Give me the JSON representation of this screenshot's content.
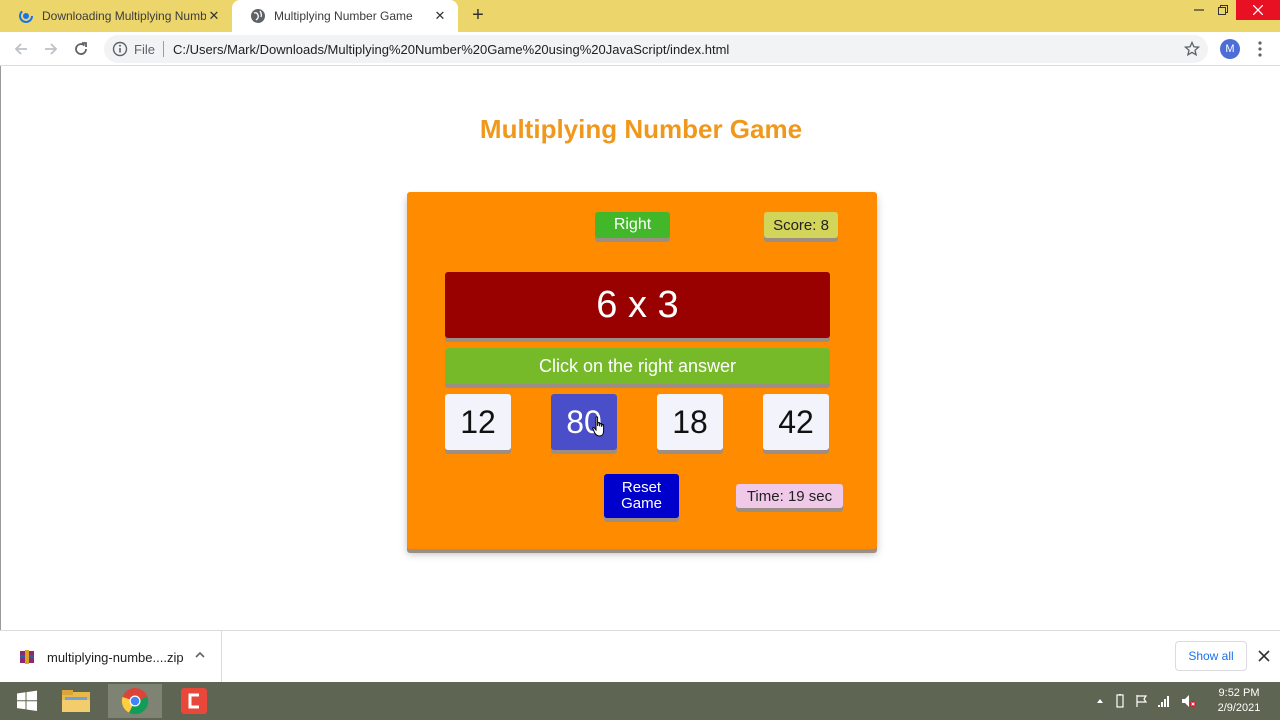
{
  "browser": {
    "tabs": [
      {
        "title": "Downloading Multiplying Numbe",
        "active": false
      },
      {
        "title": "Multiplying Number Game",
        "active": true
      }
    ],
    "address": {
      "file_label": "File",
      "url": "C:/Users/Mark/Downloads/Multiplying%20Number%20Game%20using%20JavaScript/index.html"
    },
    "profile_initial": "M",
    "accent_color": "#ecd56a"
  },
  "game": {
    "title": "Multiplying Number Game",
    "status": "Right",
    "score_label": "Score: ",
    "score_value": "8",
    "question": "6 x 3",
    "instruction": "Click on the right answer",
    "choices": [
      "12",
      "80",
      "18",
      "42"
    ],
    "hovered_choice": "80",
    "reset_label": "Reset Game",
    "time_label": "Time: ",
    "time_value": "19",
    "time_unit": " sec",
    "colors": {
      "title": "#f0981c",
      "container": "#ff8c00",
      "status": "#42b72a",
      "score": "#d3d45a",
      "question": "#990000",
      "instruction": "#76ba2a",
      "choice_hover": "#4b4ec9",
      "reset": "#0000cc",
      "time": "#f0c8e8"
    }
  },
  "downloads": {
    "item": "multiplying-numbe....zip",
    "show_all": "Show all"
  },
  "taskbar": {
    "time": "9:52 PM",
    "date": "2/9/2021"
  }
}
